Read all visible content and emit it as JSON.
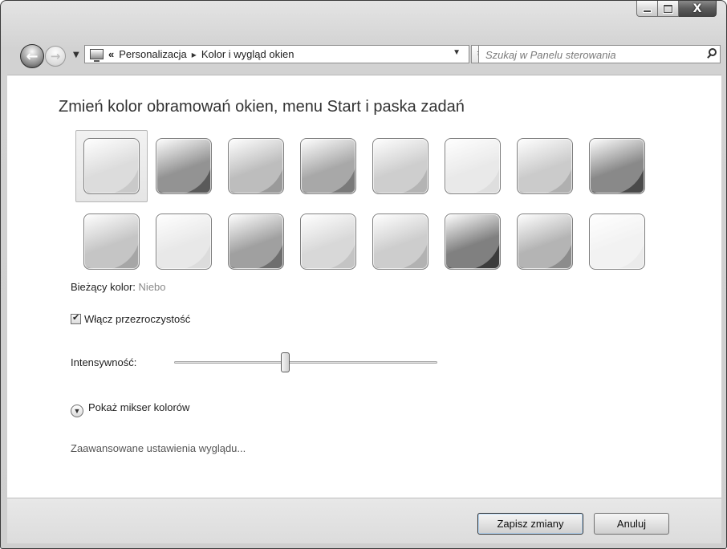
{
  "window": {
    "caption_buttons": {
      "minimize": "minimize-icon",
      "maximize": "maximize-icon",
      "close": "close-icon",
      "close_glyph": "X"
    }
  },
  "nav": {
    "back_glyph": "←",
    "forward_glyph": "→",
    "breadcrumb_prefix": "«",
    "breadcrumbs": [
      "Personalizacja",
      "Kolor i wygląd okien"
    ],
    "breadcrumb_separator": "▸",
    "search_placeholder": "Szukaj w Panelu sterowania"
  },
  "main": {
    "title": "Zmień kolor obramowań okien, menu Start i paska zadań",
    "swatch_rows": [
      [
        {
          "color": "#c9c9c9",
          "selected": true
        },
        {
          "color": "#5a5a5a",
          "selected": false
        },
        {
          "color": "#9a9a9a",
          "selected": false
        },
        {
          "color": "#7a7a7a",
          "selected": false
        },
        {
          "color": "#b4b4b4",
          "selected": false
        },
        {
          "color": "#dedede",
          "selected": false
        },
        {
          "color": "#b0b0b0",
          "selected": false
        },
        {
          "color": "#4a4a4a",
          "selected": false
        }
      ],
      [
        {
          "color": "#a6a6a6",
          "selected": false
        },
        {
          "color": "#dcdcdc",
          "selected": false
        },
        {
          "color": "#6e6e6e",
          "selected": false
        },
        {
          "color": "#c4c4c4",
          "selected": false
        },
        {
          "color": "#b2b2b2",
          "selected": false
        },
        {
          "color": "#3c3c3c",
          "selected": false
        },
        {
          "color": "#8c8c8c",
          "selected": false
        },
        {
          "color": "#ebebeb",
          "selected": false
        }
      ]
    ],
    "current_color_label": "Bieżący kolor:",
    "current_color_value": "Niebo",
    "transparency_label": "Włącz przezroczystość",
    "transparency_checked": true,
    "intensity_label": "Intensywność:",
    "intensity_level": 0.42,
    "mixer_label": "Pokaż mikser kolorów",
    "advanced_link": "Zaawansowane ustawienia wyglądu..."
  },
  "footer": {
    "save_label": "Zapisz zmiany",
    "cancel_label": "Anuluj"
  }
}
